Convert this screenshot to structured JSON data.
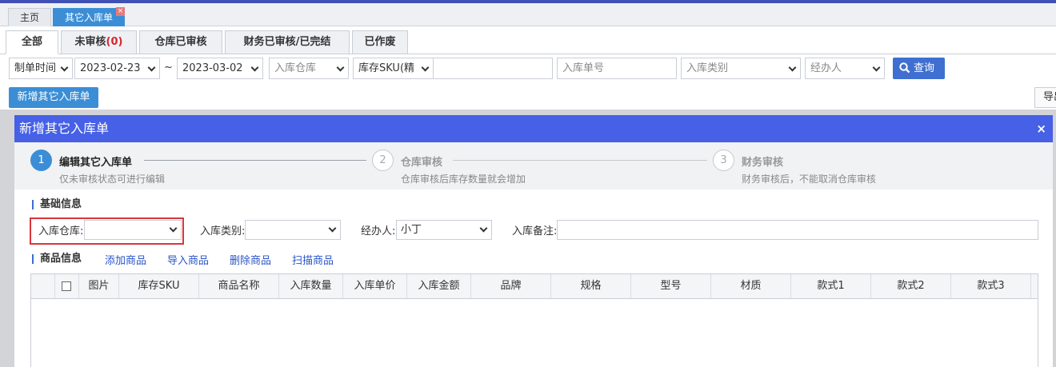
{
  "page_tabs": {
    "home": "主页",
    "active": "其它入库单",
    "close": "×"
  },
  "status_tabs": [
    {
      "label": "全部"
    },
    {
      "label": "未审核",
      "count": "(0)"
    },
    {
      "label": "仓库已审核"
    },
    {
      "label": "财务已审核/已完结"
    },
    {
      "label": "已作废"
    }
  ],
  "filters": {
    "date_type": "制单时间",
    "date_from": "2023-02-23",
    "tilde": "~",
    "date_to": "2023-03-02",
    "warehouse_placeholder": "入库仓库",
    "sku_type": "库存SKU(精",
    "order_no_placeholder": "入库单号",
    "category_placeholder": "入库类别",
    "handler_placeholder": "经办人",
    "query_label": "查询"
  },
  "toolbar": {
    "new_label": "新增其它入库单",
    "export_label": "导出"
  },
  "dialog": {
    "title": "新增其它入库单",
    "close": "×",
    "steps": [
      {
        "num": "1",
        "title": "编辑其它入库单",
        "desc": "仅未审核状态可进行编辑"
      },
      {
        "num": "2",
        "title": "仓库审核",
        "desc": "仓库审核后库存数量就会增加"
      },
      {
        "num": "3",
        "title": "财务审核",
        "desc": "财务审核后，不能取消仓库审核"
      }
    ],
    "basic_section": "基础信息",
    "form": {
      "warehouse_label": "入库仓库:",
      "warehouse_value": "",
      "category_label": "入库类别:",
      "category_value": "",
      "handler_label": "经办人:",
      "handler_value": "小丁",
      "remark_label": "入库备注:",
      "remark_value": ""
    },
    "goods_section": "商品信息",
    "goods_actions": [
      "添加商品",
      "导入商品",
      "删除商品",
      "扫描商品"
    ],
    "columns": [
      "图片",
      "库存SKU",
      "商品名称",
      "入库数量",
      "入库单价",
      "入库金额",
      "品牌",
      "规格",
      "型号",
      "材质",
      "款式1",
      "款式2",
      "款式3"
    ]
  }
}
